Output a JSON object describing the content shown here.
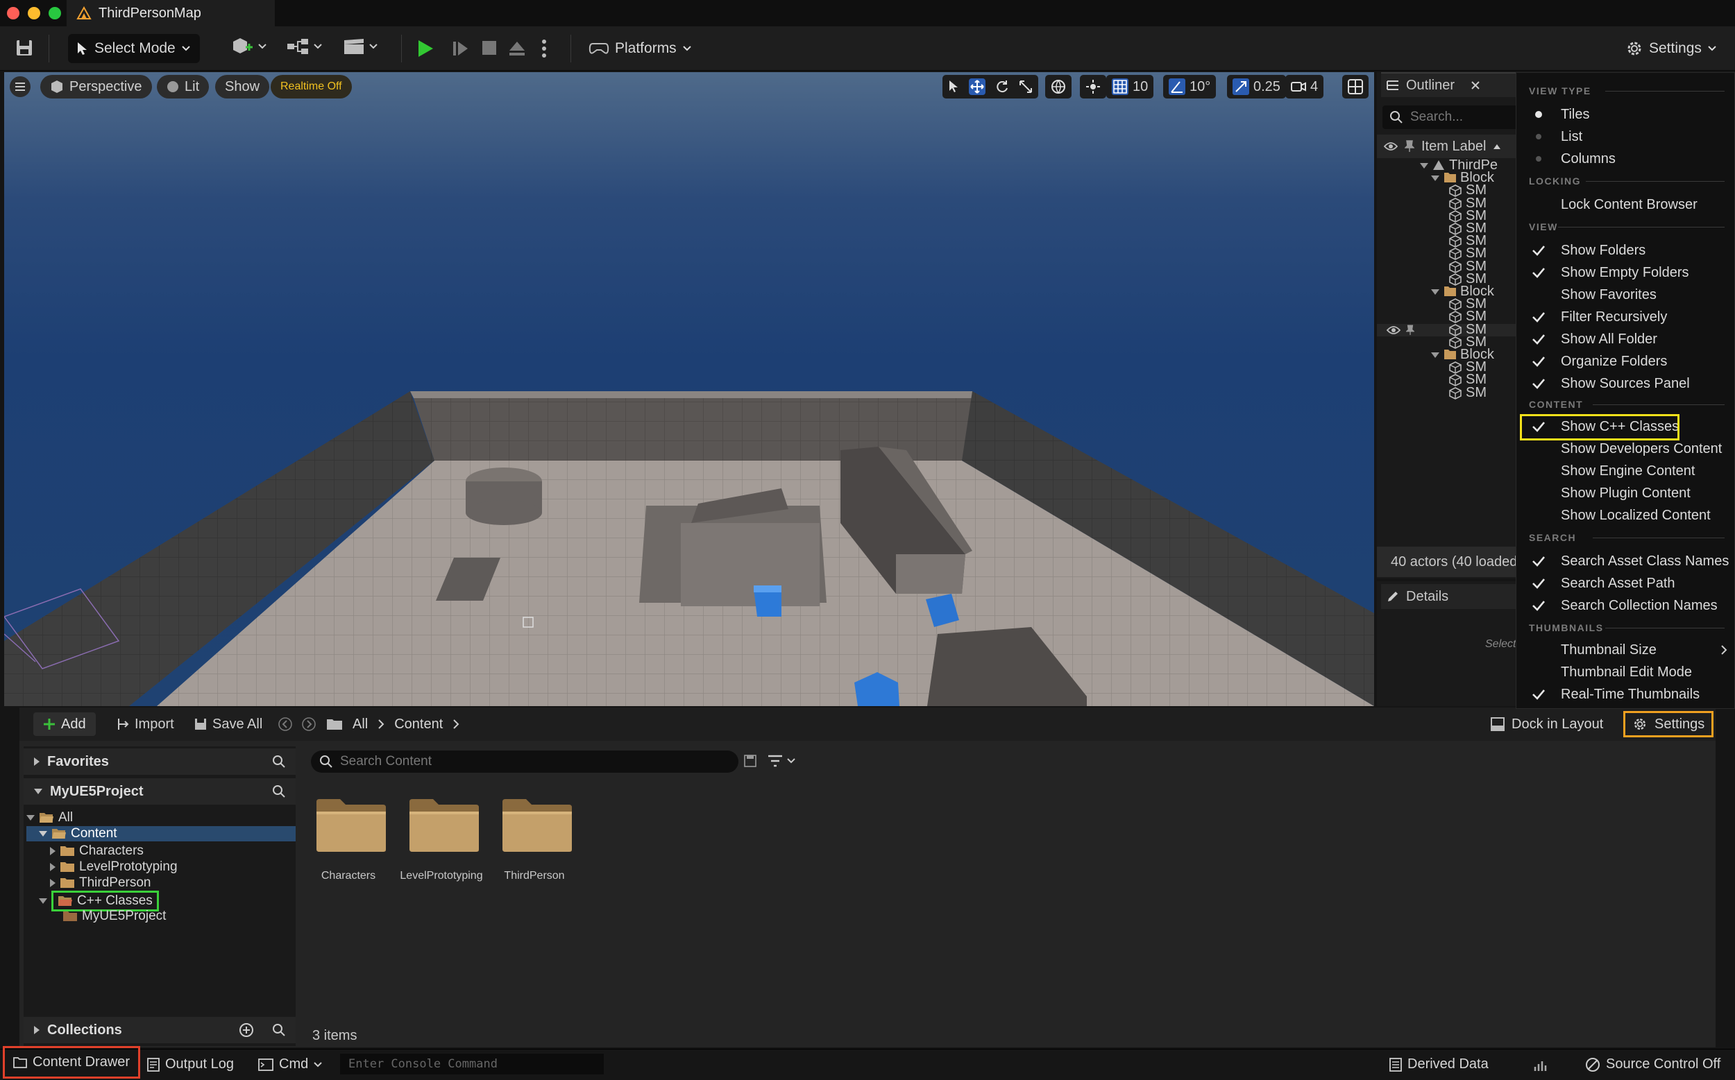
{
  "window": {
    "title": "ThirdPersonMap"
  },
  "toolbar": {
    "select_mode": "Select Mode",
    "platforms": "Platforms",
    "settings": "Settings"
  },
  "viewport": {
    "perspective": "Perspective",
    "lit": "Lit",
    "show": "Show",
    "realtime": "Realtime Off",
    "grid_snap": "10",
    "rotate_snap": "10°",
    "scale_snap": "0.25",
    "camera_speed": "4"
  },
  "outliner": {
    "tab": "Outliner",
    "search_placeholder": "Search...",
    "col_item_label": "Item Label",
    "rows": [
      "ThirdPe",
      "Block",
      "SM",
      "SM",
      "SM",
      "SM",
      "SM",
      "SM",
      "SM",
      "SM",
      "Block",
      "SM",
      "SM",
      "SM",
      "SM",
      "Block",
      "SM",
      "SM",
      "SM"
    ],
    "actors_status": "40 actors (40 loaded",
    "details_tab": "Details",
    "details_hint": "Select"
  },
  "settings_menu": {
    "sections": {
      "view_type": "VIEW TYPE",
      "locking": "LOCKING",
      "view": "VIEW",
      "content": "CONTENT",
      "search": "SEARCH",
      "thumbnails": "THUMBNAILS"
    },
    "view_type_items": [
      "Tiles",
      "List",
      "Columns"
    ],
    "lock_content_browser": "Lock Content Browser",
    "view_items": [
      {
        "label": "Show Folders",
        "checked": true
      },
      {
        "label": "Show Empty Folders",
        "checked": true
      },
      {
        "label": "Show Favorites",
        "checked": false
      },
      {
        "label": "Filter Recursively",
        "checked": true
      },
      {
        "label": "Show All Folder",
        "checked": true
      },
      {
        "label": "Organize Folders",
        "checked": true
      },
      {
        "label": "Show Sources Panel",
        "checked": true
      }
    ],
    "content_items": [
      {
        "label": "Show C++ Classes",
        "checked": true
      },
      {
        "label": "Show Developers Content",
        "checked": false
      },
      {
        "label": "Show Engine Content",
        "checked": false
      },
      {
        "label": "Show Plugin Content",
        "checked": false
      },
      {
        "label": "Show Localized Content",
        "checked": false
      }
    ],
    "search_items": [
      {
        "label": "Search Asset Class Names",
        "checked": true
      },
      {
        "label": "Search Asset Path",
        "checked": true
      },
      {
        "label": "Search Collection Names",
        "checked": true
      }
    ],
    "thumbnail_items": [
      {
        "label": "Thumbnail Size",
        "checked": false
      },
      {
        "label": "Thumbnail Edit Mode",
        "checked": false
      },
      {
        "label": "Real-Time Thumbnails",
        "checked": true
      }
    ]
  },
  "content_browser": {
    "add": "Add",
    "import": "Import",
    "save_all": "Save All",
    "breadcrumb": [
      "All",
      "Content"
    ],
    "dock_in_layout": "Dock in Layout",
    "settings": "Settings",
    "favorites": "Favorites",
    "project": "MyUE5Project",
    "tree": {
      "all": "All",
      "content": "Content",
      "characters": "Characters",
      "level_prototyping": "LevelPrototyping",
      "third_person": "ThirdPerson",
      "cpp_classes": "C++ Classes",
      "my_project": "MyUE5Project"
    },
    "collections": "Collections",
    "search_placeholder": "Search Content",
    "folders": [
      "Characters",
      "LevelPrototyping",
      "ThirdPerson"
    ],
    "items_count": "3 items"
  },
  "statusbar": {
    "content_drawer": "Content Drawer",
    "output_log": "Output Log",
    "cmd": "Cmd",
    "console_placeholder": "Enter Console Command",
    "derived_data": "Derived Data",
    "source_control": "Source Control Off"
  },
  "highlight_colors": {
    "yellow": "#f5e11a",
    "orange": "#f0a020",
    "green": "#3ad03a",
    "red": "#e0402a"
  }
}
